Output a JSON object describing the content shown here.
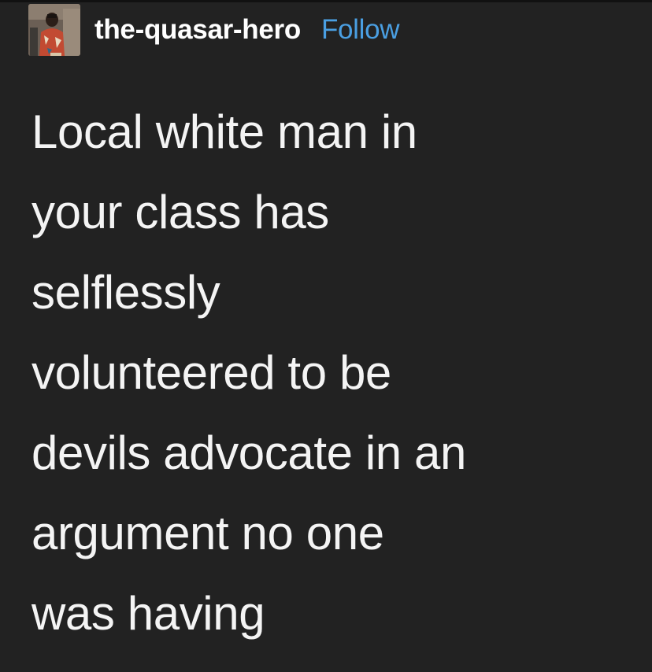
{
  "post": {
    "author": {
      "username": "the-quasar-hero",
      "avatar_icon": "user-avatar-photo"
    },
    "follow_label": "Follow",
    "text_lines": [
      "Local white man in",
      "your class has",
      "selflessly",
      "volunteered to be",
      "devils advocate in an",
      "argument no one",
      "was having"
    ]
  },
  "colors": {
    "background": "#222222",
    "text": "#f4f4f4",
    "username": "#ffffff",
    "link": "#4a9fe2"
  }
}
